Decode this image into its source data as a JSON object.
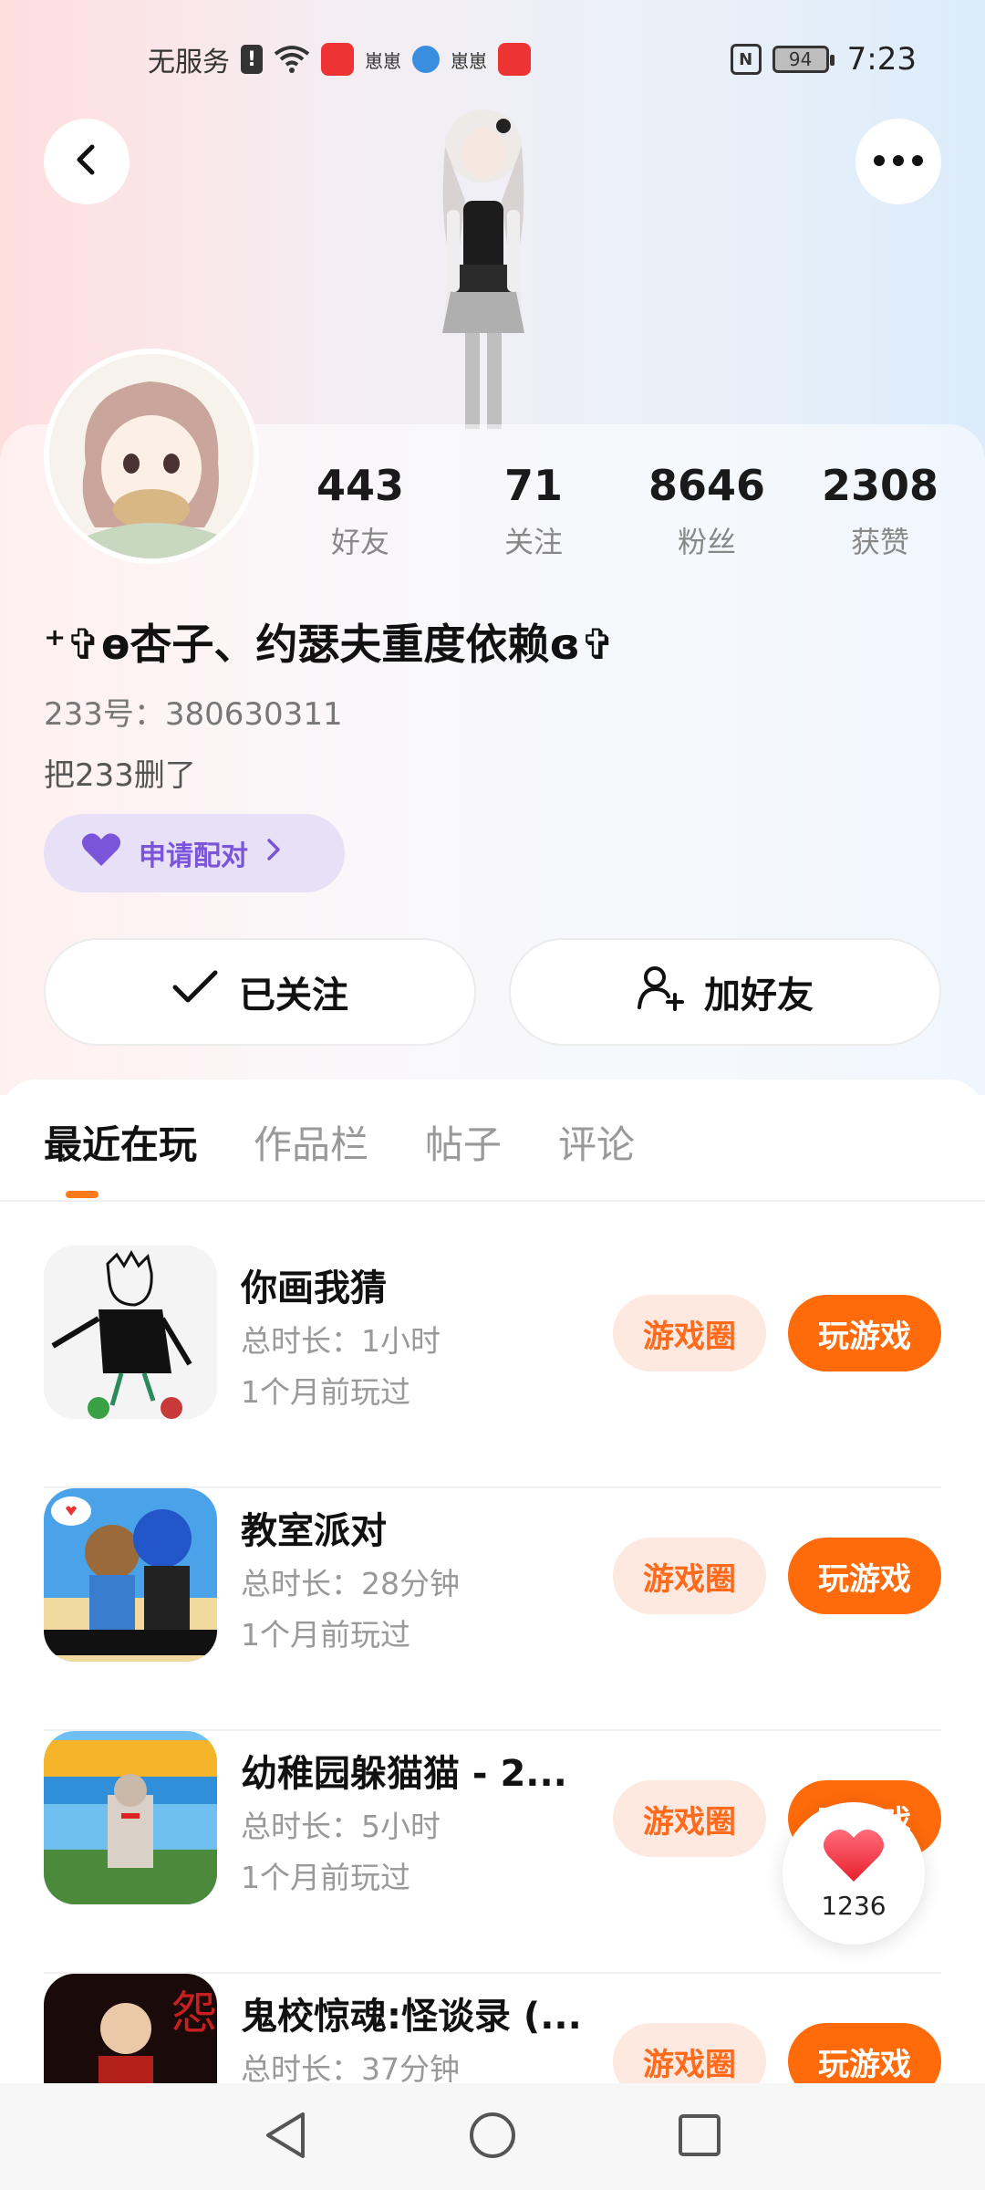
{
  "status_bar": {
    "carrier": "无服务",
    "app_label_1": "崽崽",
    "app_label_2": "崽崽",
    "battery": "94",
    "time": "7:23"
  },
  "icons": {
    "back": "chevron-left-icon",
    "more": "more-horizontal-icon",
    "heart": "heart-icon",
    "check": "check-icon",
    "add_user": "add-user-icon"
  },
  "colors": {
    "accent_orange": "#ff6a0a",
    "pair_purple": "#7a55d9",
    "pair_bg": "#e7e0f7"
  },
  "stats": [
    {
      "value": "443",
      "label": "好友"
    },
    {
      "value": "71",
      "label": "关注"
    },
    {
      "value": "8646",
      "label": "粉丝"
    },
    {
      "value": "2308",
      "label": "获赞"
    }
  ],
  "profile": {
    "nickname": "⁺✞ɵ杏子、约瑟夫重度依赖ɞ✞",
    "id_text": "233号：380630311",
    "bio": "把233删了",
    "pair_label": "申请配对"
  },
  "actions": {
    "follow": "已关注",
    "add_friend": "加好友"
  },
  "tabs": [
    {
      "label": "最近在玩"
    },
    {
      "label": "作品栏"
    },
    {
      "label": "帖子"
    },
    {
      "label": "评论"
    }
  ],
  "games": [
    {
      "title": "你画我猜",
      "duration": "总时长：1小时",
      "last": "1个月前玩过",
      "circle": "游戏圈",
      "play": "玩游戏"
    },
    {
      "title": "教室派对",
      "duration": "总时长：28分钟",
      "last": "1个月前玩过",
      "circle": "游戏圈",
      "play": "玩游戏"
    },
    {
      "title": "幼稚园躲猫猫 - 2...",
      "duration": "总时长：5小时",
      "last": "1个月前玩过",
      "circle": "游戏圈",
      "play": "玩游戏"
    },
    {
      "title": "鬼校惊魂:怪谈录 (...",
      "duration": "总时长：37分钟",
      "last": "",
      "circle": "游戏圈",
      "play": "玩游戏"
    }
  ],
  "like_float": {
    "count": "1236"
  }
}
